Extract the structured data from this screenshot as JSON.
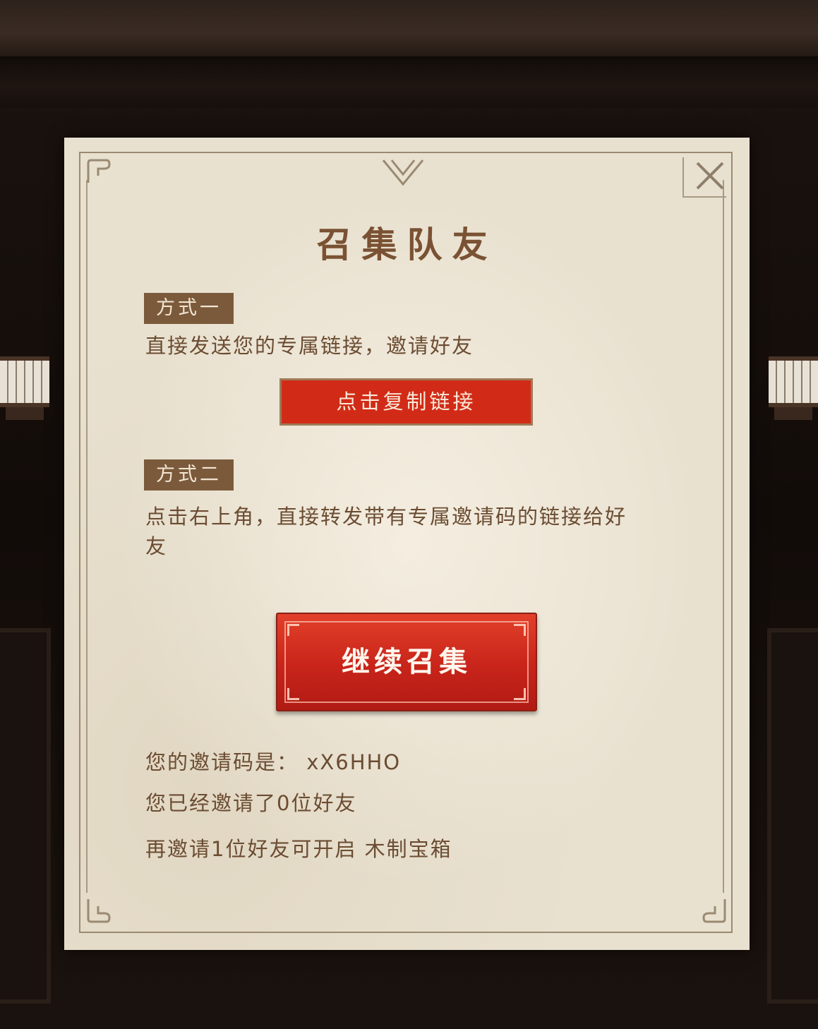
{
  "dialog": {
    "title": "召集队友",
    "close_icon": "close-icon",
    "method_one": {
      "tag": "方式一",
      "description": "直接发送您的专属链接，邀请好友",
      "button": "点击复制链接"
    },
    "method_two": {
      "tag": "方式二",
      "description": "点击右上角，直接转发带有专属邀请码的链接给好友"
    },
    "continue_button": "继续召集",
    "invite_code_line": "您的邀请码是： xX6HHO",
    "invited_count_line": "您已经邀请了0位好友",
    "reward_line": "再邀请1位好友可开启 木制宝箱"
  },
  "colors": {
    "parchment": "#e9e1d0",
    "title_brown": "#7a5233",
    "tag_bg": "#7b5a3c",
    "button_red": "#d12b17"
  }
}
